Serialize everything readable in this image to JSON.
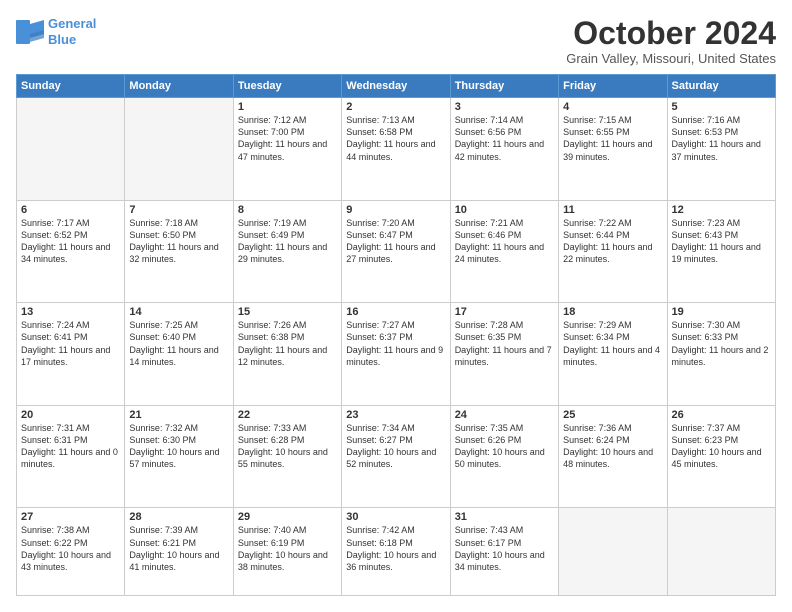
{
  "logo": {
    "line1": "General",
    "line2": "Blue"
  },
  "title": "October 2024",
  "location": "Grain Valley, Missouri, United States",
  "days_of_week": [
    "Sunday",
    "Monday",
    "Tuesday",
    "Wednesday",
    "Thursday",
    "Friday",
    "Saturday"
  ],
  "weeks": [
    [
      {
        "day": "",
        "sunrise": "",
        "sunset": "",
        "daylight": ""
      },
      {
        "day": "",
        "sunrise": "",
        "sunset": "",
        "daylight": ""
      },
      {
        "day": "1",
        "sunrise": "Sunrise: 7:12 AM",
        "sunset": "Sunset: 7:00 PM",
        "daylight": "Daylight: 11 hours and 47 minutes."
      },
      {
        "day": "2",
        "sunrise": "Sunrise: 7:13 AM",
        "sunset": "Sunset: 6:58 PM",
        "daylight": "Daylight: 11 hours and 44 minutes."
      },
      {
        "day": "3",
        "sunrise": "Sunrise: 7:14 AM",
        "sunset": "Sunset: 6:56 PM",
        "daylight": "Daylight: 11 hours and 42 minutes."
      },
      {
        "day": "4",
        "sunrise": "Sunrise: 7:15 AM",
        "sunset": "Sunset: 6:55 PM",
        "daylight": "Daylight: 11 hours and 39 minutes."
      },
      {
        "day": "5",
        "sunrise": "Sunrise: 7:16 AM",
        "sunset": "Sunset: 6:53 PM",
        "daylight": "Daylight: 11 hours and 37 minutes."
      }
    ],
    [
      {
        "day": "6",
        "sunrise": "Sunrise: 7:17 AM",
        "sunset": "Sunset: 6:52 PM",
        "daylight": "Daylight: 11 hours and 34 minutes."
      },
      {
        "day": "7",
        "sunrise": "Sunrise: 7:18 AM",
        "sunset": "Sunset: 6:50 PM",
        "daylight": "Daylight: 11 hours and 32 minutes."
      },
      {
        "day": "8",
        "sunrise": "Sunrise: 7:19 AM",
        "sunset": "Sunset: 6:49 PM",
        "daylight": "Daylight: 11 hours and 29 minutes."
      },
      {
        "day": "9",
        "sunrise": "Sunrise: 7:20 AM",
        "sunset": "Sunset: 6:47 PM",
        "daylight": "Daylight: 11 hours and 27 minutes."
      },
      {
        "day": "10",
        "sunrise": "Sunrise: 7:21 AM",
        "sunset": "Sunset: 6:46 PM",
        "daylight": "Daylight: 11 hours and 24 minutes."
      },
      {
        "day": "11",
        "sunrise": "Sunrise: 7:22 AM",
        "sunset": "Sunset: 6:44 PM",
        "daylight": "Daylight: 11 hours and 22 minutes."
      },
      {
        "day": "12",
        "sunrise": "Sunrise: 7:23 AM",
        "sunset": "Sunset: 6:43 PM",
        "daylight": "Daylight: 11 hours and 19 minutes."
      }
    ],
    [
      {
        "day": "13",
        "sunrise": "Sunrise: 7:24 AM",
        "sunset": "Sunset: 6:41 PM",
        "daylight": "Daylight: 11 hours and 17 minutes."
      },
      {
        "day": "14",
        "sunrise": "Sunrise: 7:25 AM",
        "sunset": "Sunset: 6:40 PM",
        "daylight": "Daylight: 11 hours and 14 minutes."
      },
      {
        "day": "15",
        "sunrise": "Sunrise: 7:26 AM",
        "sunset": "Sunset: 6:38 PM",
        "daylight": "Daylight: 11 hours and 12 minutes."
      },
      {
        "day": "16",
        "sunrise": "Sunrise: 7:27 AM",
        "sunset": "Sunset: 6:37 PM",
        "daylight": "Daylight: 11 hours and 9 minutes."
      },
      {
        "day": "17",
        "sunrise": "Sunrise: 7:28 AM",
        "sunset": "Sunset: 6:35 PM",
        "daylight": "Daylight: 11 hours and 7 minutes."
      },
      {
        "day": "18",
        "sunrise": "Sunrise: 7:29 AM",
        "sunset": "Sunset: 6:34 PM",
        "daylight": "Daylight: 11 hours and 4 minutes."
      },
      {
        "day": "19",
        "sunrise": "Sunrise: 7:30 AM",
        "sunset": "Sunset: 6:33 PM",
        "daylight": "Daylight: 11 hours and 2 minutes."
      }
    ],
    [
      {
        "day": "20",
        "sunrise": "Sunrise: 7:31 AM",
        "sunset": "Sunset: 6:31 PM",
        "daylight": "Daylight: 11 hours and 0 minutes."
      },
      {
        "day": "21",
        "sunrise": "Sunrise: 7:32 AM",
        "sunset": "Sunset: 6:30 PM",
        "daylight": "Daylight: 10 hours and 57 minutes."
      },
      {
        "day": "22",
        "sunrise": "Sunrise: 7:33 AM",
        "sunset": "Sunset: 6:28 PM",
        "daylight": "Daylight: 10 hours and 55 minutes."
      },
      {
        "day": "23",
        "sunrise": "Sunrise: 7:34 AM",
        "sunset": "Sunset: 6:27 PM",
        "daylight": "Daylight: 10 hours and 52 minutes."
      },
      {
        "day": "24",
        "sunrise": "Sunrise: 7:35 AM",
        "sunset": "Sunset: 6:26 PM",
        "daylight": "Daylight: 10 hours and 50 minutes."
      },
      {
        "day": "25",
        "sunrise": "Sunrise: 7:36 AM",
        "sunset": "Sunset: 6:24 PM",
        "daylight": "Daylight: 10 hours and 48 minutes."
      },
      {
        "day": "26",
        "sunrise": "Sunrise: 7:37 AM",
        "sunset": "Sunset: 6:23 PM",
        "daylight": "Daylight: 10 hours and 45 minutes."
      }
    ],
    [
      {
        "day": "27",
        "sunrise": "Sunrise: 7:38 AM",
        "sunset": "Sunset: 6:22 PM",
        "daylight": "Daylight: 10 hours and 43 minutes."
      },
      {
        "day": "28",
        "sunrise": "Sunrise: 7:39 AM",
        "sunset": "Sunset: 6:21 PM",
        "daylight": "Daylight: 10 hours and 41 minutes."
      },
      {
        "day": "29",
        "sunrise": "Sunrise: 7:40 AM",
        "sunset": "Sunset: 6:19 PM",
        "daylight": "Daylight: 10 hours and 38 minutes."
      },
      {
        "day": "30",
        "sunrise": "Sunrise: 7:42 AM",
        "sunset": "Sunset: 6:18 PM",
        "daylight": "Daylight: 10 hours and 36 minutes."
      },
      {
        "day": "31",
        "sunrise": "Sunrise: 7:43 AM",
        "sunset": "Sunset: 6:17 PM",
        "daylight": "Daylight: 10 hours and 34 minutes."
      },
      {
        "day": "",
        "sunrise": "",
        "sunset": "",
        "daylight": ""
      },
      {
        "day": "",
        "sunrise": "",
        "sunset": "",
        "daylight": ""
      }
    ]
  ]
}
